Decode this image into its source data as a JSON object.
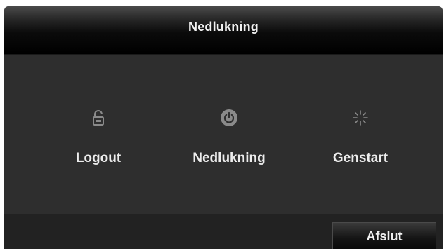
{
  "dialog": {
    "title": "Nedlukning"
  },
  "actions": [
    {
      "id": "logout",
      "label": "Logout",
      "icon": "lock-icon"
    },
    {
      "id": "shutdown",
      "label": "Nedlukning",
      "icon": "power-icon"
    },
    {
      "id": "restart",
      "label": "Genstart",
      "icon": "restart-spinner-icon"
    }
  ],
  "footer": {
    "exit_label": "Afslut"
  },
  "colors": {
    "background": "#2e2e2e",
    "titlebar": "#000000",
    "text": "#ededed",
    "icon": "#8a8a8a"
  }
}
